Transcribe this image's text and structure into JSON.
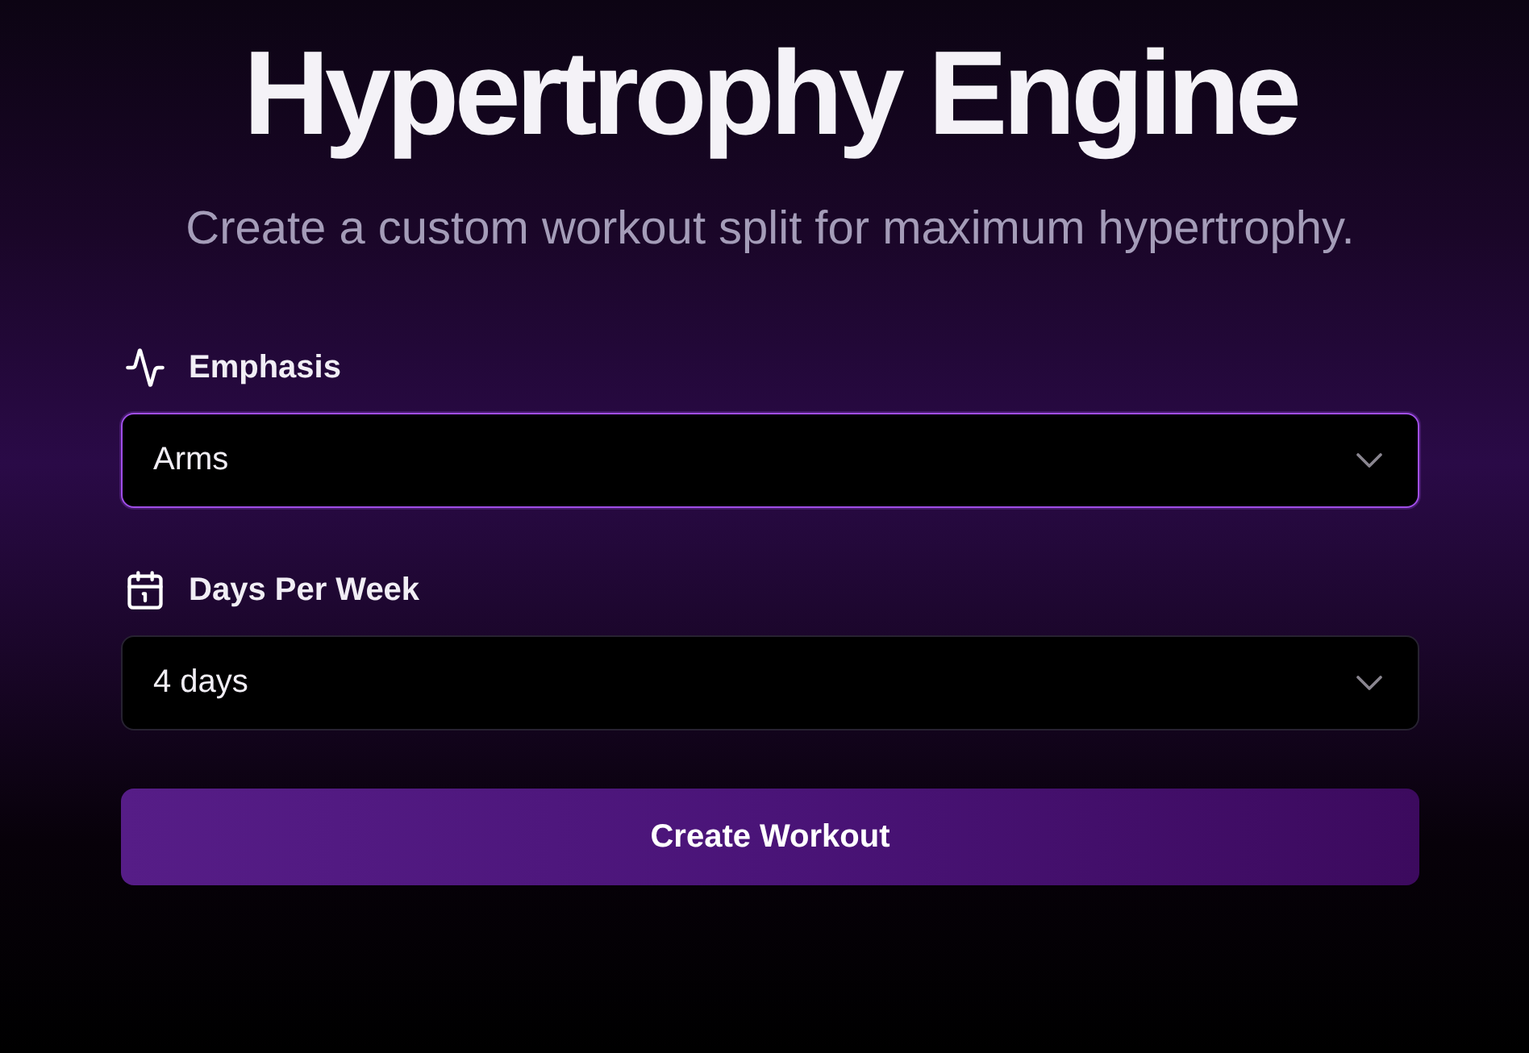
{
  "header": {
    "title": "Hypertrophy Engine",
    "subtitle": "Create a custom workout split for maximum hypertrophy."
  },
  "fields": [
    {
      "label": "Emphasis",
      "value": "Arms",
      "focused": true
    },
    {
      "label": "Days Per Week",
      "value": "4 days",
      "focused": false
    }
  ],
  "submit": {
    "label": "Create Workout"
  }
}
